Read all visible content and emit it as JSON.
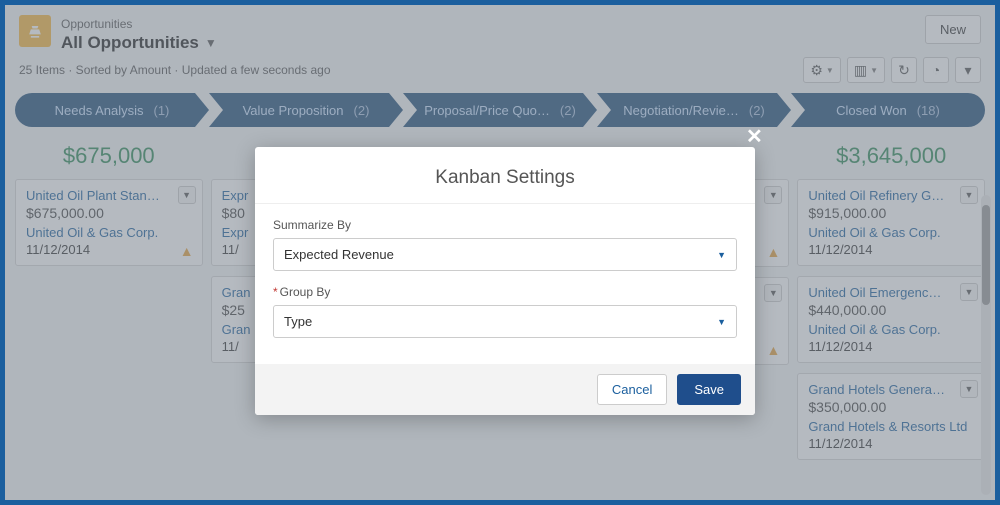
{
  "header": {
    "object_label": "Opportunities",
    "view_name": "All Opportunities",
    "new_button": "New",
    "meta": "25 Items · Sorted by Amount · Updated a few seconds ago"
  },
  "stages": [
    {
      "label": "Needs Analysis",
      "count": "(1)",
      "total": "$675,000"
    },
    {
      "label": "Value Proposition",
      "count": "(2)"
    },
    {
      "label": "Proposal/Price Quo…",
      "count": "(2)"
    },
    {
      "label": "Negotiation/Revie…",
      "count": "(2)"
    },
    {
      "label": "Closed Won",
      "count": "(18)",
      "total": "$3,645,000"
    }
  ],
  "col0_cards": [
    {
      "name": "United Oil Plant Standby…",
      "amt": "$675,000.00",
      "acct": "United Oil & Gas Corp.",
      "date": "11/12/2014",
      "warn": true
    }
  ],
  "col1_cards": [
    {
      "name": "Expr",
      "amt": "$80",
      "acct": "Expr",
      "date": "11/"
    },
    {
      "name": "Gran",
      "amt": "$25",
      "acct": "Gran",
      "date": "11/"
    }
  ],
  "col3_cards": [
    {
      "warn": true
    },
    {
      "warn": true
    }
  ],
  "col4_cards": [
    {
      "name": "United Oil Refinery G…",
      "amt": "$915,000.00",
      "acct": "United Oil & Gas Corp.",
      "date": "11/12/2014"
    },
    {
      "name": "United Oil Emergenc…",
      "amt": "$440,000.00",
      "acct": "United Oil & Gas Corp.",
      "date": "11/12/2014"
    },
    {
      "name": "Grand Hotels Genera…",
      "amt": "$350,000.00",
      "acct": "Grand Hotels & Resorts Ltd",
      "date": "11/12/2014"
    }
  ],
  "modal": {
    "title": "Kanban Settings",
    "summarize_label": "Summarize By",
    "summarize_value": "Expected Revenue",
    "group_label": "Group By",
    "group_value": "Type",
    "cancel": "Cancel",
    "save": "Save"
  }
}
